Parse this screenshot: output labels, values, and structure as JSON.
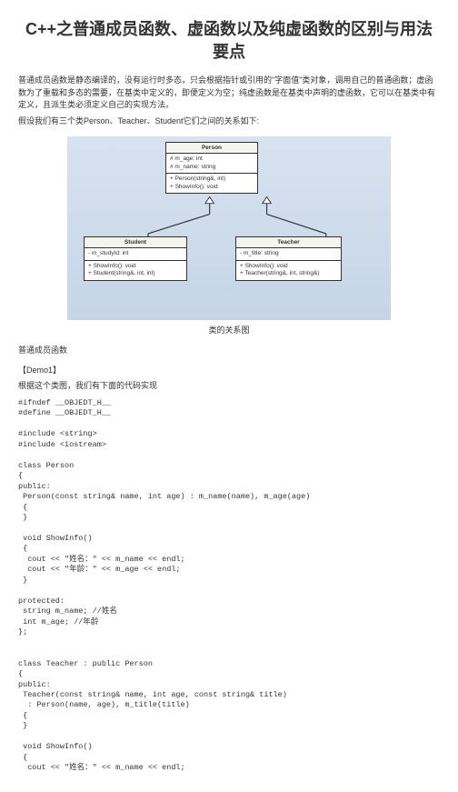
{
  "title": "C++之普通成员函数、虚函数以及纯虚函数的区别与用法要点",
  "intro1": "普通成员函数是静态编译的，没有运行时多态，只会根据指针或引用的\"字面值\"类对象，调用自己的普通函数；虚函数为了重载和多态的需要，在基类中定义的，即便定义为空；纯虚函数是在基类中声明的虚函数，它可以在基类中有定义，且派生类必须定义自己的实现方法。",
  "intro2": "假设我们有三个类Person、Teacher、Student它们之间的关系如下:",
  "uml": {
    "person": {
      "name": "Person",
      "attrs": "# m_age: int\n# m_name: string",
      "ops": "+ Person(string&, int)\n+ ShowInfo(): void"
    },
    "student": {
      "name": "Student",
      "attrs": "- m_studyId: int",
      "ops": "+ ShowInfo(): void\n+ Student(string&, int, int)"
    },
    "teacher": {
      "name": "Teacher",
      "attrs": "- m_title: string",
      "ops": "+ ShowInfo(): void\n+ Teacher(string&, int, string&)"
    }
  },
  "caption": "类的关系图",
  "section1": "普通成员函数",
  "demo1": "【Demo1】",
  "demo1desc": "根据这个类图，我们有下面的代码实现",
  "code": "#ifndef __OBJEDT_H__\n#define __OBJEDT_H__\n\n#include <string>\n#include <iostream>\n\nclass Person\n{\npublic:\n Person(const string& name, int age) : m_name(name), m_age(age)\n {\n }\n\n void ShowInfo()\n {\n  cout << \"姓名：\" << m_name << endl;\n  cout << \"年龄：\" << m_age << endl;\n }\n\nprotected:\n string m_name; //姓名\n int m_age; //年龄\n};\n\n\nclass Teacher : public Person\n{\npublic:\n Teacher(const string& name, int age, const string& title)\n  : Person(name, age), m_title(title)\n {\n }\n\n void ShowInfo()\n {\n  cout << \"姓名：\" << m_name << endl;"
}
